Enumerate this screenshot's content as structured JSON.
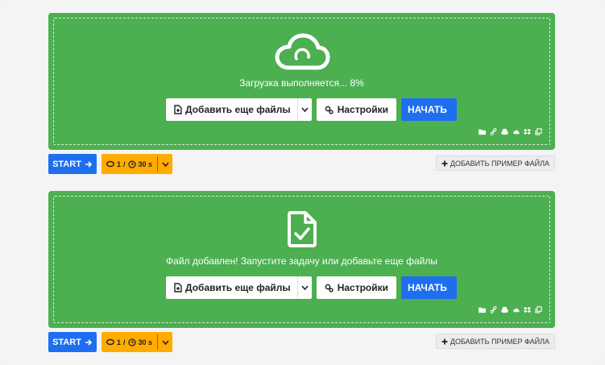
{
  "panels": [
    {
      "message": "Загрузка выполняется...  8%",
      "add_files": "Добавить еще файлы",
      "settings": "Настройки",
      "start": "НАЧАТЬ"
    },
    {
      "message": "Файл добавлен! Запустите задачу или добавьте еще файлы",
      "add_files": "Добавить еще файлы",
      "settings": "Настройки",
      "start": "НАЧАТЬ"
    }
  ],
  "footers": [
    {
      "start": "START",
      "count": "1",
      "slash": "/",
      "time": "30 s",
      "sample": "ДОБАВИТЬ ПРИМЕР ФАЙЛА"
    },
    {
      "start": "START",
      "count": "1",
      "slash": "/",
      "time": "30 s",
      "sample": "ДОБАВИТЬ ПРИМЕР ФАЙЛА"
    }
  ],
  "colors": {
    "panel": "#4caf50",
    "primary": "#1e6ff0",
    "accent": "#ffab00"
  },
  "upload_progress_percent": 8
}
